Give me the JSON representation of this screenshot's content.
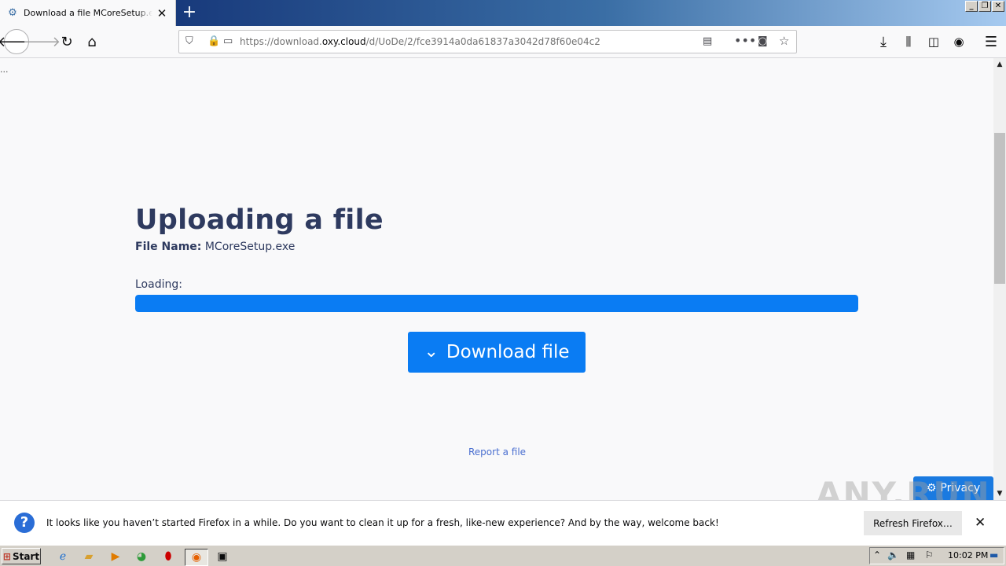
{
  "browser": {
    "tab_title": "Download a file MCoreSetup.exe o",
    "url_prefix": "https://download.",
    "url_domain": "oxy.cloud",
    "url_path": "/d/UoDe/2/fce3914a0da61837a3042d78f60e04c2"
  },
  "page": {
    "dots": "...",
    "heading": "Uploading a file",
    "file_name_label": "File Name:",
    "file_name_value": "MCoreSetup.exe",
    "loading_label": "Loading:",
    "progress": 1.0,
    "download_label": "Download file",
    "report_link": "Report a file",
    "privacy_label": "Privacy",
    "accent_color": "#0a7cf3"
  },
  "notification": {
    "text": "It looks like you haven’t started Firefox in a while. Do you want to clean it up for a fresh, like-new experience? And by the way, welcome back!",
    "refresh_label": "Refresh Firefox…"
  },
  "watermark": "ANY.RUN",
  "taskbar": {
    "start_label": "Start",
    "clock": "10:02 PM"
  }
}
